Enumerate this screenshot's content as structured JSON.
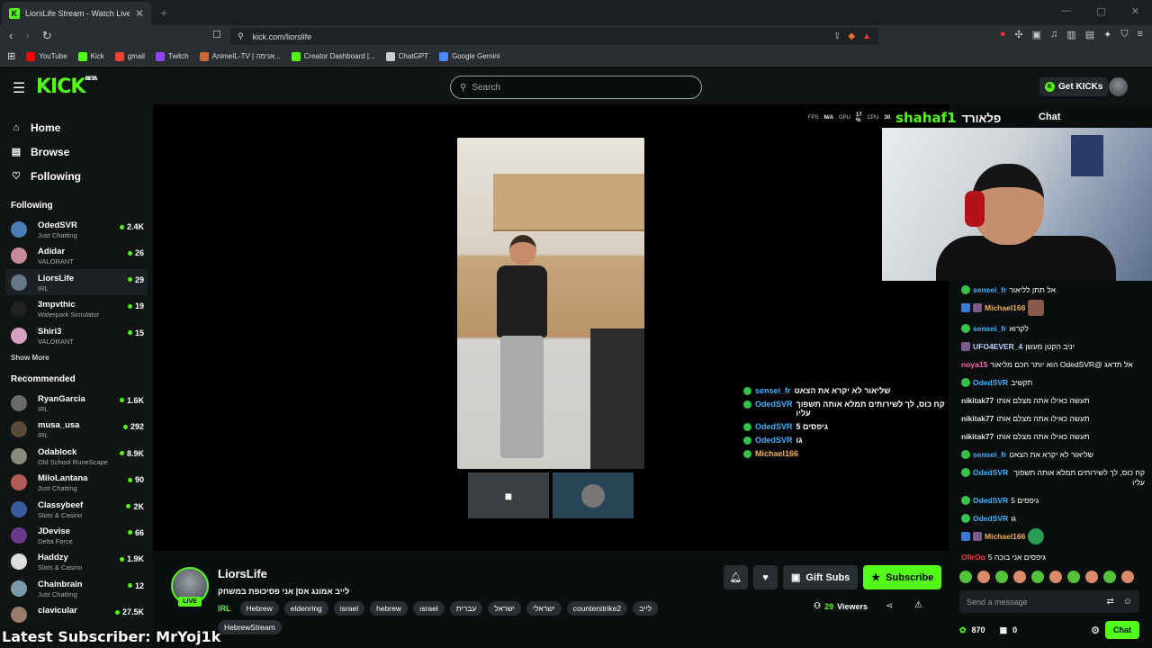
{
  "browser": {
    "tab_title": "LiorsLife Stream - Watch Live on",
    "url": "kick.com/liorslife",
    "bookmarks": [
      {
        "label": "YouTube",
        "color": "#ff0000"
      },
      {
        "label": "Kick",
        "color": "#53fc18"
      },
      {
        "label": "gmail",
        "color": "#ea4335"
      },
      {
        "label": "Twitch",
        "color": "#9146ff"
      },
      {
        "label": "AnimeIL-TV | אנימה...",
        "color": "#cc6633"
      },
      {
        "label": "Creator Dashboard |...",
        "color": "#53fc18"
      },
      {
        "label": "ChatGPT",
        "color": "#cccccc"
      },
      {
        "label": "Google Gemini",
        "color": "#4a8af4"
      }
    ]
  },
  "header": {
    "search_placeholder": "Search",
    "get_kicks": "Get KICKs",
    "logo": "KICK",
    "logo_beta": "BETA"
  },
  "sidebar": {
    "nav": [
      {
        "label": "Home",
        "icon": "home-icon"
      },
      {
        "label": "Browse",
        "icon": "browse-icon"
      },
      {
        "label": "Following",
        "icon": "heart-icon"
      }
    ],
    "following_title": "Following",
    "following": [
      {
        "name": "OdedSVR",
        "game": "Just Chatting",
        "viewers": "2.4K",
        "color": "#4a7fb5"
      },
      {
        "name": "Adidar",
        "game": "VALORANT",
        "viewers": "26",
        "color": "#c98a9a"
      },
      {
        "name": "LiorsLife",
        "game": "IRL",
        "viewers": "29",
        "color": "#667788"
      },
      {
        "name": "3mpvthic",
        "game": "Waterpark Simulator",
        "viewers": "19",
        "color": "#222222"
      },
      {
        "name": "Shiri3",
        "game": "VALORANT",
        "viewers": "15",
        "color": "#d8a0c0"
      }
    ],
    "show_more": "Show More",
    "recommended_title": "Recommended",
    "recommended": [
      {
        "name": "RyanGarcia",
        "game": "IRL",
        "viewers": "1.6K",
        "color": "#6a6a6a"
      },
      {
        "name": "musa_usa",
        "game": "IRL",
        "viewers": "292",
        "color": "#5a4a3a"
      },
      {
        "name": "Odablock",
        "game": "Old School RuneScape",
        "viewers": "8.9K",
        "color": "#8a8a7a"
      },
      {
        "name": "MiloLantana",
        "game": "Just Chatting",
        "viewers": "90",
        "color": "#b55a5a"
      },
      {
        "name": "Classybeef",
        "game": "Slots & Casino",
        "viewers": "2K",
        "color": "#3a5a9a"
      },
      {
        "name": "JDevise",
        "game": "Delta Force",
        "viewers": "66",
        "color": "#6a3a8a"
      },
      {
        "name": "Haddzy",
        "game": "Slots & Casino",
        "viewers": "1.9K",
        "color": "#dddddd"
      },
      {
        "name": "Chainbrain",
        "game": "Just Chatting",
        "viewers": "12",
        "color": "#7a9aaa"
      },
      {
        "name": "clavicular",
        "game": "",
        "viewers": "27.5K",
        "color": "#9a7a6a"
      }
    ]
  },
  "player": {
    "hud_fps_label": "FPS",
    "hud_fps": "N/A",
    "hud_gpu_label": "GPU",
    "hud_gpu": "17 %",
    "hud_cpu_label": "CPU",
    "hud_cpu": "30",
    "hud_name": "shahaf1",
    "hud_hebrew": "פלאורד",
    "overlay_chat": [
      {
        "user": "sensei_fr",
        "text": "שליאור לא יקרא את הצאט",
        "color": "#3db3ff"
      },
      {
        "user": "OdedSVR",
        "text": "קח כוס, לך לשירותים תמלא אותה תשפוך עליו",
        "color": "#3db3ff"
      },
      {
        "user": "OdedSVR",
        "text": "גיפסים 5",
        "color": "#3db3ff"
      },
      {
        "user": "OdedSVR",
        "text": "גו",
        "color": "#3db3ff"
      },
      {
        "user": "Michael166",
        "text": "",
        "color": "#f0b050"
      }
    ],
    "last_subscriber": "Latest Subscriber: MrYoj1k"
  },
  "chat": {
    "title": "Chat",
    "messages": [
      {
        "user": "sensei_fr",
        "text": "אל תתן לליאור",
        "color": "#3db3ff",
        "badges": [
          "gb"
        ]
      },
      {
        "user": "Michael166",
        "text": "",
        "color": "#f0b050",
        "badges": [
          "sq",
          "sq p"
        ],
        "emote": "emo"
      },
      {
        "user": "sensei_fr",
        "text": "לקרוא",
        "color": "#3db3ff",
        "badges": [
          "gb"
        ]
      },
      {
        "user": "UFO4EVER_4",
        "text": "יניב הקטן מעשן",
        "color": "#b9d3ff",
        "badges": [
          "sq p"
        ]
      },
      {
        "user": "noya15",
        "text": "אל תדאג @OdedSVR הוא יותר חכם מליאור",
        "color": "#ff6eb4",
        "badges": []
      },
      {
        "user": "OdedSVR",
        "text": "תקשיב",
        "color": "#3db3ff",
        "badges": [
          "gb"
        ]
      },
      {
        "user": "nikitak77",
        "text": "תעשה כאילו אתה מצלם אותו",
        "color": "#e0e0e0",
        "badges": []
      },
      {
        "user": "nikitak77",
        "text": "תעשה כאילו אתה מצלם אותו",
        "color": "#e0e0e0",
        "badges": []
      },
      {
        "user": "nikitak77",
        "text": "תעשה כאילו אתה מצלם אותו",
        "color": "#e0e0e0",
        "badges": []
      },
      {
        "user": "sensei_fr",
        "text": "שליאור לא יקרא את הצאט",
        "color": "#3db3ff",
        "badges": [
          "gb"
        ]
      },
      {
        "user": "OdedSVR",
        "text": "קח כוס, לך לשירותים תמלא אותה תשפוך עליו",
        "color": "#3db3ff",
        "badges": [
          "gb"
        ]
      },
      {
        "user": "OdedSVR",
        "text": "גיפסים 5",
        "color": "#3db3ff",
        "badges": [
          "gb"
        ]
      },
      {
        "user": "OdedSVR",
        "text": "גו",
        "color": "#3db3ff",
        "badges": [
          "gb"
        ]
      },
      {
        "user": "Michael166",
        "text": "",
        "color": "#f0b050",
        "badges": [
          "sq",
          "sq p"
        ],
        "emote": "emo g"
      },
      {
        "user": "OfirOo",
        "text": "גיפסים אני בוכה 5",
        "color": "#ff3b3b",
        "badges": []
      }
    ],
    "send_placeholder": "Send a message",
    "kicks": "870",
    "points": "0",
    "chat_button": "Chat"
  },
  "stream": {
    "name": "LiorsLife",
    "live": "LIVE",
    "title": "לייב אמונג אס| אני פסיכופת במשחק",
    "category": "IRL",
    "tags": [
      "Hebrew",
      "eldenring",
      "israel",
      "hebrew",
      "ısrael",
      "עברית",
      "ישראל",
      "ישראלי",
      "counterstrike2",
      "לייב",
      "HebrewStream"
    ],
    "gift_subs": "Gift Subs",
    "subscribe": "Subscribe",
    "viewers_count": "29",
    "viewers_label": "Viewers"
  }
}
